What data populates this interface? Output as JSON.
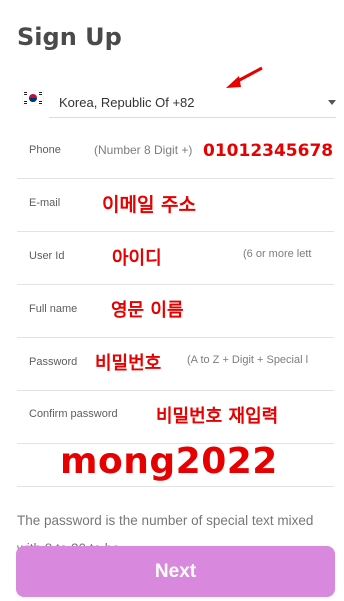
{
  "page": {
    "title": "Sign Up"
  },
  "country": {
    "value": "Korea, Republic Of +82",
    "flag_icon": "kr-flag"
  },
  "fields": {
    "phone": {
      "label": "Phone",
      "hint": "(Number 8 Digit +)",
      "annotation": "01012345678"
    },
    "email": {
      "label": "E-mail",
      "annotation": "이메일 주소"
    },
    "userid": {
      "label": "User Id",
      "hint": "(6 or more lett",
      "annotation": "아이디"
    },
    "fullname": {
      "label": "Full name",
      "annotation": "영문 이름"
    },
    "password": {
      "label": "Password",
      "hint": "(A to Z + Digit + Special l",
      "annotation": "비밀번호"
    },
    "confirm": {
      "label": "Confirm password",
      "annotation": "비밀번호 재입력"
    }
  },
  "big_annotation": "mong2022",
  "note": "The password is the number of special text mixed with 8 to 20 to be",
  "next_button": {
    "label": "Next",
    "color": "#d989dd"
  },
  "colors": {
    "annotation_red": "#e60000"
  }
}
